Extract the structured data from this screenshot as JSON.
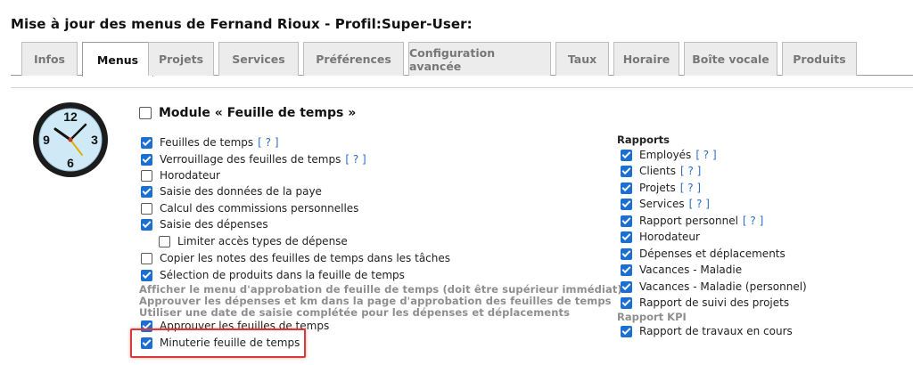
{
  "page_title": "Mise à jour des menus de Fernand Rioux - Profil:Super-User:",
  "tabs": [
    {
      "label": "Infos",
      "active": false
    },
    {
      "label": "Menus",
      "active": true
    },
    {
      "label": "Projets",
      "active": false
    },
    {
      "label": "Services",
      "active": false
    },
    {
      "label": "Préférences",
      "active": false
    },
    {
      "label": "Configuration avancée",
      "active": false
    },
    {
      "label": "Taux",
      "active": false
    },
    {
      "label": "Horaire",
      "active": false
    },
    {
      "label": "Boîte vocale",
      "active": false
    },
    {
      "label": "Produits",
      "active": false
    }
  ],
  "clock_icon": {
    "name": "clock-icon",
    "numbers": [
      "12",
      "3",
      "6",
      "9"
    ]
  },
  "module": {
    "label": "Module « Feuille de temps »",
    "checked": false
  },
  "left_items": [
    {
      "label": "Feuilles de temps",
      "checked": true,
      "help": "[ ? ]"
    },
    {
      "label": "Verrouillage des feuilles de temps",
      "checked": true,
      "help": "[ ? ]"
    },
    {
      "label": "Horodateur",
      "checked": false
    },
    {
      "label": "Saisie des données de la paye",
      "checked": true
    },
    {
      "label": "Calcul des commissions personnelles",
      "checked": false
    },
    {
      "label": "Saisie des dépenses",
      "checked": true
    },
    {
      "label": "Limiter accès types de dépense",
      "checked": false
    },
    {
      "label": "Copier les notes des feuilles de temps dans les tâches",
      "checked": false
    },
    {
      "label": "Sélection de produits dans la feuille de temps",
      "checked": true
    }
  ],
  "disabled_notes": [
    "Afficher le menu d'approbation de feuille de temps (doit être supérieur immédiat)",
    "Approuver les dépenses et km dans la page d'approbation des feuilles de temps",
    "Utiliser une date de saisie complétée pour les dépenses et déplacements"
  ],
  "approve_item": {
    "label": "Approuver les feuilles de temps",
    "checked": true
  },
  "timer_item": {
    "label": "Minuterie feuille de temps",
    "checked": true
  },
  "rapports": {
    "heading": "Rapports",
    "items": [
      {
        "label": "Employés",
        "checked": true,
        "help": "[ ? ]"
      },
      {
        "label": "Clients",
        "checked": true,
        "help": "[ ? ]"
      },
      {
        "label": "Projets",
        "checked": true,
        "help": "[ ? ]"
      },
      {
        "label": "Services",
        "checked": true,
        "help": "[ ? ]"
      },
      {
        "label": "Rapport personnel",
        "checked": true,
        "help": "[ ? ]"
      },
      {
        "label": "Horodateur",
        "checked": true
      },
      {
        "label": "Dépenses et déplacements",
        "checked": true
      },
      {
        "label": "Vacances - Maladie",
        "checked": true
      },
      {
        "label": "Vacances - Maladie (personnel)",
        "checked": true
      },
      {
        "label": "Rapport de suivi des projets",
        "checked": true
      }
    ]
  },
  "rapport_kpi": {
    "heading": "Rapport KPI",
    "items": [
      {
        "label": "Rapport de travaux en cours",
        "checked": true
      }
    ]
  },
  "colors": {
    "accent": "#1a6fd1",
    "highlight": "#d63a3a",
    "muted": "#8e8e8e"
  }
}
